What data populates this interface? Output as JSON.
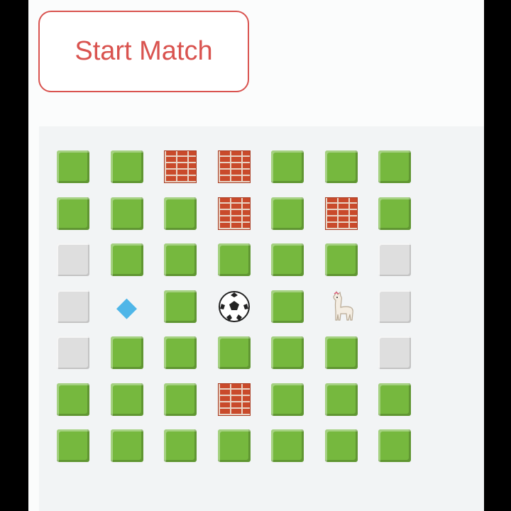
{
  "controls": {
    "start_label": "Start Match"
  },
  "colors": {
    "accent": "#d9534f",
    "grass": "#76b83e",
    "wall": "#c94a2b",
    "empty": "#dedede",
    "board_bg": "#f2f4f5"
  },
  "board": {
    "rows": 7,
    "cols": 7,
    "grid": [
      [
        "grass",
        "grass",
        "wall",
        "wall",
        "grass",
        "grass",
        "grass"
      ],
      [
        "grass",
        "grass",
        "grass",
        "wall",
        "grass",
        "wall",
        "grass"
      ],
      [
        "empty",
        "grass",
        "grass",
        "grass",
        "grass",
        "grass",
        "empty"
      ],
      [
        "empty",
        "gem",
        "grass",
        "ball",
        "grass",
        "llama",
        "empty"
      ],
      [
        "empty",
        "grass",
        "grass",
        "grass",
        "grass",
        "grass",
        "empty"
      ],
      [
        "grass",
        "grass",
        "grass",
        "wall",
        "grass",
        "grass",
        "grass"
      ],
      [
        "grass",
        "grass",
        "grass",
        "grass",
        "grass",
        "grass",
        "grass"
      ]
    ],
    "icons": {
      "gem": "gem-icon",
      "ball": "soccer-ball-icon",
      "llama": "llama-icon"
    }
  }
}
